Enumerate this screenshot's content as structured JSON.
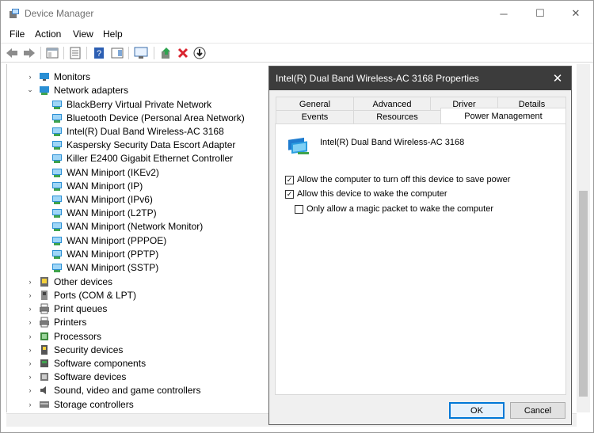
{
  "window": {
    "title": "Device Manager",
    "caption": {
      "minimize": "─",
      "maximize": "☐",
      "close": "✕"
    }
  },
  "menu": [
    "File",
    "Action",
    "View",
    "Help"
  ],
  "tree": {
    "items": [
      {
        "label": "Monitors",
        "expander": "›",
        "icon": "monitor-icon"
      },
      {
        "label": "Network adapters",
        "expander": "⌄",
        "icon": "network-adapter-icon"
      },
      {
        "label": "BlackBerry Virtual Private Network",
        "icon": "network-card-icon"
      },
      {
        "label": "Bluetooth Device (Personal Area Network)",
        "icon": "network-card-icon"
      },
      {
        "label": "Intel(R) Dual Band Wireless-AC 3168",
        "icon": "network-card-icon"
      },
      {
        "label": "Kaspersky Security Data Escort Adapter",
        "icon": "network-card-icon"
      },
      {
        "label": "Killer E2400 Gigabit Ethernet Controller",
        "icon": "network-card-icon"
      },
      {
        "label": "WAN Miniport (IKEv2)",
        "icon": "network-card-icon"
      },
      {
        "label": "WAN Miniport (IP)",
        "icon": "network-card-icon"
      },
      {
        "label": "WAN Miniport (IPv6)",
        "icon": "network-card-icon"
      },
      {
        "label": "WAN Miniport (L2TP)",
        "icon": "network-card-icon"
      },
      {
        "label": "WAN Miniport (Network Monitor)",
        "icon": "network-card-icon"
      },
      {
        "label": "WAN Miniport (PPPOE)",
        "icon": "network-card-icon"
      },
      {
        "label": "WAN Miniport (PPTP)",
        "icon": "network-card-icon"
      },
      {
        "label": "WAN Miniport (SSTP)",
        "icon": "network-card-icon"
      },
      {
        "label": "Other devices",
        "expander": "›",
        "icon": "unknown-device-icon"
      },
      {
        "label": "Ports (COM & LPT)",
        "expander": "›",
        "icon": "port-icon"
      },
      {
        "label": "Print queues",
        "expander": "›",
        "icon": "printer-icon"
      },
      {
        "label": "Printers",
        "expander": "›",
        "icon": "printer-icon"
      },
      {
        "label": "Processors",
        "expander": "›",
        "icon": "processor-icon"
      },
      {
        "label": "Security devices",
        "expander": "›",
        "icon": "security-device-icon"
      },
      {
        "label": "Software components",
        "expander": "›",
        "icon": "software-component-icon"
      },
      {
        "label": "Software devices",
        "expander": "›",
        "icon": "software-device-icon"
      },
      {
        "label": "Sound, video and game controllers",
        "expander": "›",
        "icon": "speaker-icon"
      },
      {
        "label": "Storage controllers",
        "expander": "›",
        "icon": "storage-icon"
      }
    ]
  },
  "dialog": {
    "title": "Intel(R) Dual Band Wireless-AC 3168 Properties",
    "tabs_row1": [
      "General",
      "Advanced",
      "Driver",
      "Details"
    ],
    "tabs_row2": [
      "Events",
      "Resources",
      "Power Management"
    ],
    "active_tab": "Power Management",
    "device_name": "Intel(R) Dual Band Wireless-AC 3168",
    "options": [
      {
        "label": "Allow the computer to turn off this device to save power",
        "checked": true
      },
      {
        "label": "Allow this device to wake the computer",
        "checked": true
      },
      {
        "label": "Only allow a magic packet to wake the computer",
        "checked": false
      }
    ],
    "ok_label": "OK",
    "cancel_label": "Cancel",
    "close_glyph": "✕"
  },
  "colors": {
    "dialog_titlebar": "#3c3c3c",
    "accent": "#0078d7",
    "adapter_icon": "#2a8fd4"
  }
}
